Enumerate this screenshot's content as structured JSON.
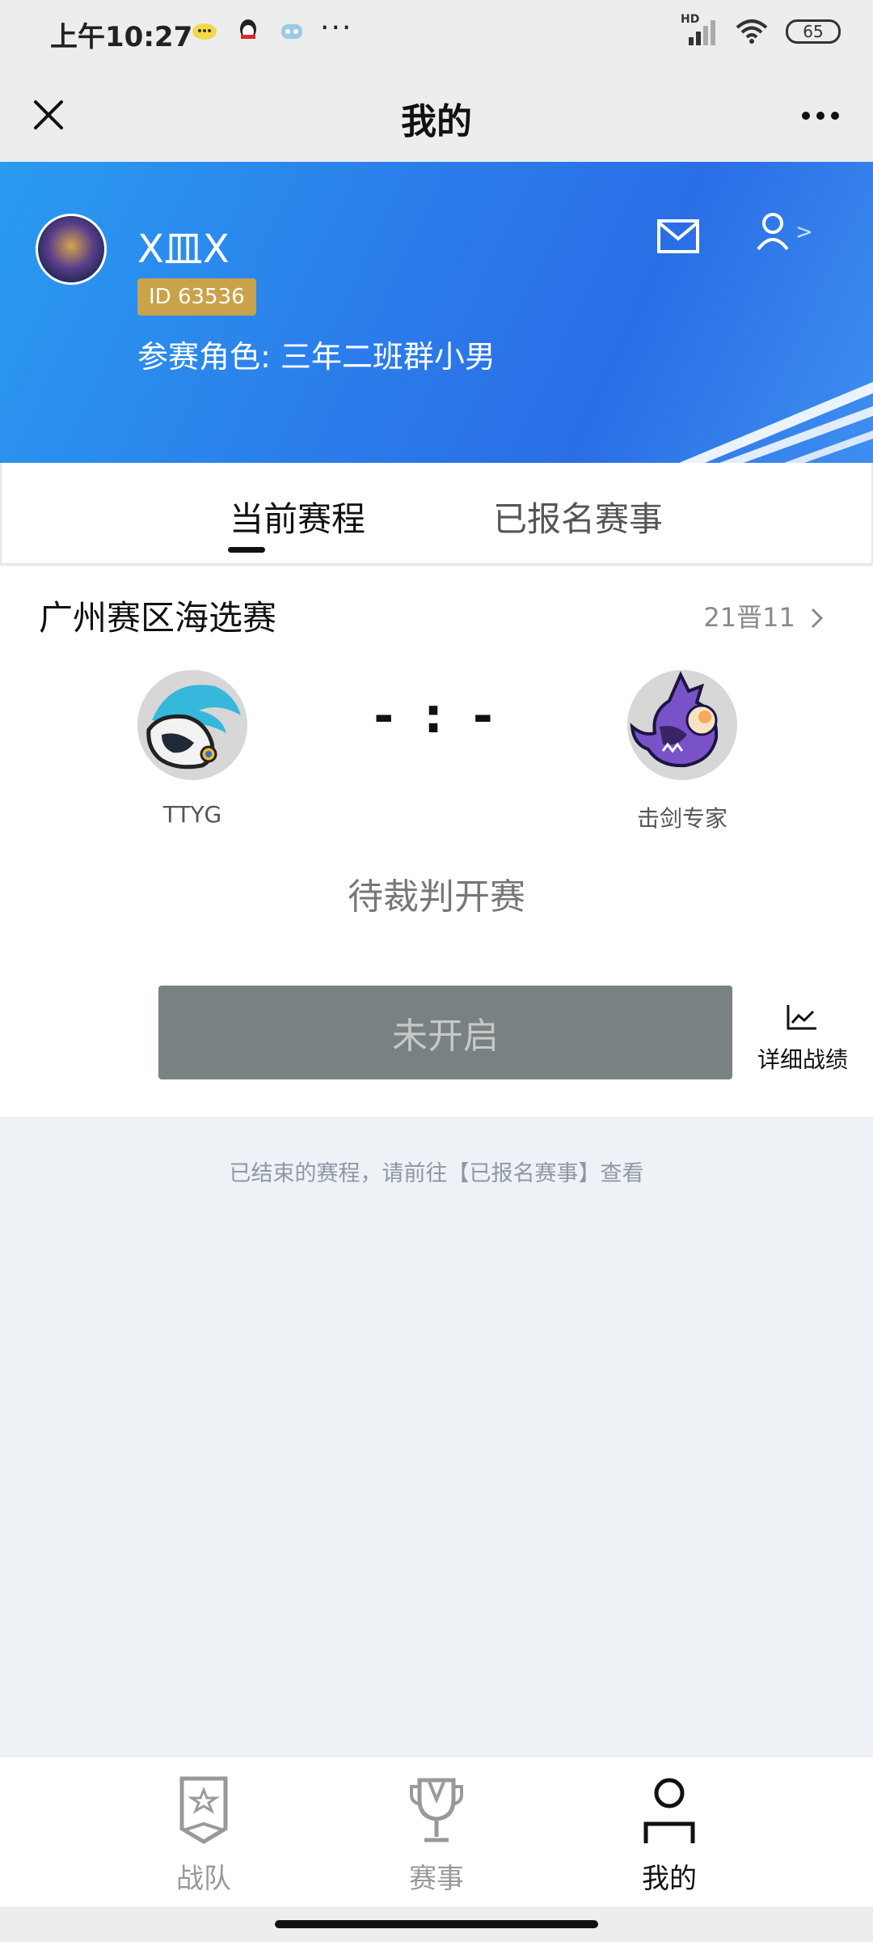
{
  "status_bar": {
    "time": "上午10:27",
    "more": "···",
    "network": "HD",
    "battery": "65"
  },
  "header": {
    "title": "我的"
  },
  "profile": {
    "name": "X皿X",
    "id_label": "ID 63536",
    "role": "参赛角色: 三年二班群小男",
    "chevron": ">"
  },
  "tabs": {
    "current": "当前赛程",
    "registered": "已报名赛事"
  },
  "match": {
    "title": "广州赛区海选赛",
    "progress": "21晋11",
    "left_team": "TTYG",
    "right_team": "击剑专家",
    "score": "- : -",
    "status": "待裁判开赛",
    "start_button": "未开启",
    "stats_label": "详细战绩"
  },
  "footer_note": "已结束的赛程，请前往【已报名赛事】查看",
  "nav": {
    "team": "战队",
    "events": "赛事",
    "mine": "我的"
  },
  "colors": {
    "banner": "#2b7cea",
    "badge": "#c9a24a",
    "button_disabled": "#7a8182",
    "background": "#eef1f6"
  }
}
